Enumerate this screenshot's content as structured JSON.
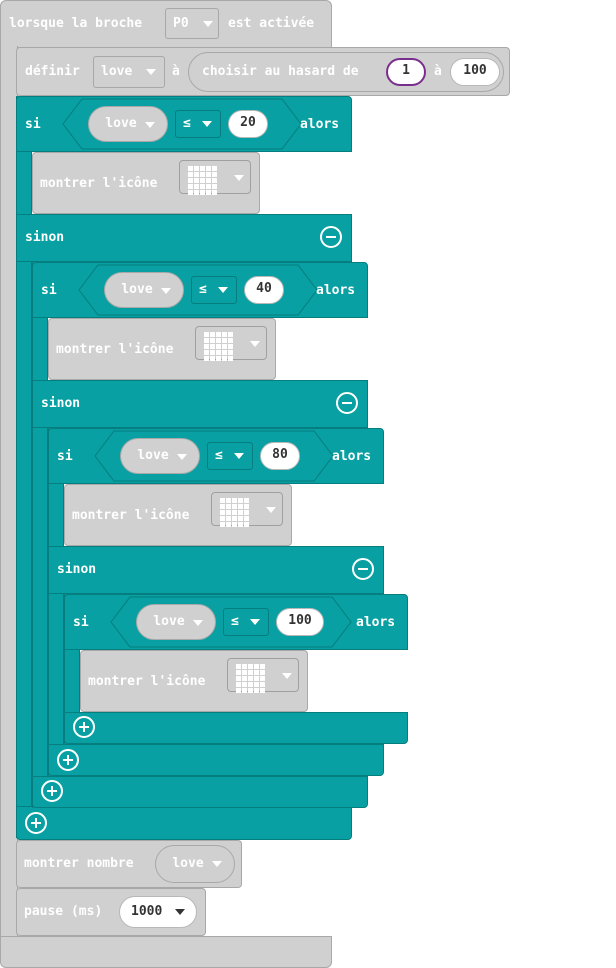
{
  "event": {
    "prefix": "lorsque la broche",
    "pin": "P0",
    "suffix": "est activée"
  },
  "set_block": {
    "label": "définir",
    "variable": "love",
    "to": "à",
    "random_label": "choisir au hasard de",
    "from": "1",
    "between": "à",
    "max": "100"
  },
  "if_1": {
    "si": "si",
    "variable": "love",
    "operator": "≤",
    "value": "20",
    "alors": "alors",
    "show_icon": "montrer l'icône",
    "sinon": "sinon"
  },
  "if_2": {
    "si": "si",
    "variable": "love",
    "operator": "≤",
    "value": "40",
    "alors": "alors",
    "show_icon": "montrer l'icône",
    "sinon": "sinon"
  },
  "if_3": {
    "si": "si",
    "variable": "love",
    "operator": "≤",
    "value": "80",
    "alors": "alors",
    "show_icon": "montrer l'icône",
    "sinon": "sinon"
  },
  "if_4": {
    "si": "si",
    "variable": "love",
    "operator": "≤",
    "value": "100",
    "alors": "alors",
    "show_icon": "montrer l'icône"
  },
  "show_number": {
    "label": "montrer nombre",
    "variable": "love"
  },
  "pause": {
    "label": "pause (ms)",
    "value": "1000"
  },
  "colors": {
    "logic": "#08a0a2",
    "gray_block": "#d0d0d0",
    "selected_outline": "#7a2e8c"
  },
  "icons": [
    "caret-down-icon",
    "led-grid-icon",
    "minus-circle-icon",
    "plus-circle-icon"
  ]
}
